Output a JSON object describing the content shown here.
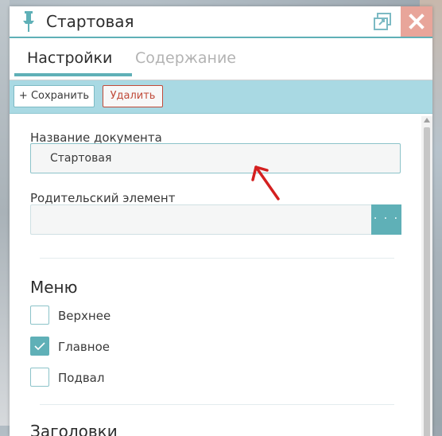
{
  "window": {
    "title": "Стартовая"
  },
  "tabs": [
    {
      "label": "Настройки",
      "active": true
    },
    {
      "label": "Содержание",
      "active": false
    }
  ],
  "toolbar": {
    "save_label": "+ Сохранить",
    "delete_label": "Удалить"
  },
  "form": {
    "doc_name": {
      "label": "Название документа",
      "value": "Стартовая"
    },
    "parent": {
      "label": "Родительский элемент",
      "value": "",
      "browse_label": "· · ·"
    }
  },
  "menu": {
    "title": "Меню",
    "items": [
      {
        "label": "Верхнее",
        "checked": false
      },
      {
        "label": "Главное",
        "checked": true
      },
      {
        "label": "Подвал",
        "checked": false
      }
    ]
  },
  "next_section": {
    "title": "Заголовки"
  },
  "colors": {
    "accent": "#5fb0b7",
    "toolbar_bg": "#a9d9e3",
    "delete": "#c04b3a",
    "close_bg": "#e8a59a",
    "annotation_arrow": "#d42020"
  },
  "icons": {
    "pin": "pin-icon",
    "restore": "restore-window-icon",
    "close": "close-icon",
    "check": "checkmark-icon"
  }
}
